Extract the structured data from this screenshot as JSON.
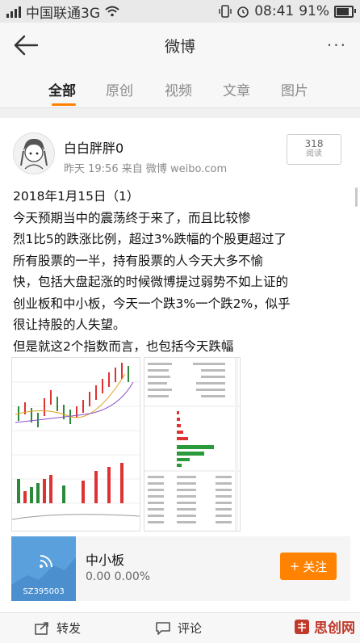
{
  "status_bar": {
    "carrier": "中国联通3G",
    "time": "08:41",
    "battery": "91%"
  },
  "header": {
    "title": "微博",
    "more": "···"
  },
  "tabs": [
    "全部",
    "原创",
    "视频",
    "文章",
    "图片"
  ],
  "post": {
    "username": "白白胖胖0",
    "meta": "昨天 19:56  来自 微博 weibo.com",
    "read_count": "318",
    "read_label": "阅读",
    "lines": [
      "2018年1月15日（1）",
      "今天预期当中的震荡终于来了，而且比较惨",
      "烈1比5的跌涨比例，超过3%跌幅的个股更超过了",
      "所有股票的一半，持有股票的人今天大多不愉",
      "快，包括大盘起涨的时候微博提过弱势不如上证的",
      "创业板和中小板，今天一个跌3%一个跌2%，似乎",
      "很让持股的人失望。",
      "但是就这2个指数而言，也包括今天跌幅"
    ]
  },
  "stock_card": {
    "name": "中小板",
    "quote": "0.00  0.00%",
    "code": "SZ395003",
    "follow": "关注",
    "follow_icon": "+"
  },
  "bottom_bar": {
    "repost": "转发",
    "comment": "评论"
  },
  "watermark": {
    "text": "思创网"
  },
  "colors": {
    "accent": "#ff8200",
    "stock_thumb": "#5aa0dc",
    "watermark": "#c0392b"
  }
}
